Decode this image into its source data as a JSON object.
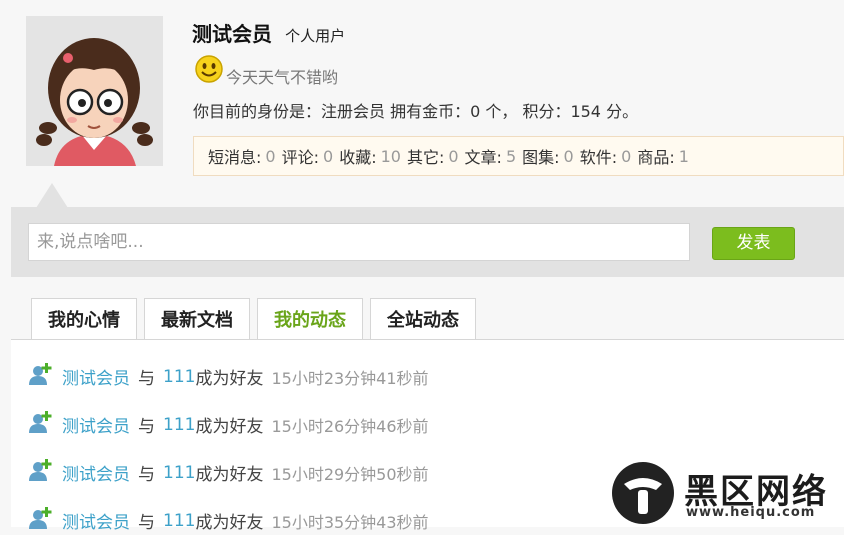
{
  "profile": {
    "name": "测试会员",
    "user_type": "个人用户",
    "mood": "今天天气不错哟",
    "identity": "你目前的身份是：注册会员 拥有金币：0 个， 积分：154 分。"
  },
  "stats": [
    {
      "label": "短消息:",
      "value": "0"
    },
    {
      "label": "评论:",
      "value": "0"
    },
    {
      "label": "收藏:",
      "value": "10"
    },
    {
      "label": "其它:",
      "value": "0"
    },
    {
      "label": "文章:",
      "value": "5"
    },
    {
      "label": "图集:",
      "value": "0"
    },
    {
      "label": "软件:",
      "value": "0"
    },
    {
      "label": "商品:",
      "value": "1"
    }
  ],
  "post": {
    "placeholder": "来,说点啥吧...",
    "submit_label": "发表"
  },
  "tabs": [
    {
      "label": "我的心情",
      "active": false
    },
    {
      "label": "最新文档",
      "active": false
    },
    {
      "label": "我的动态",
      "active": true
    },
    {
      "label": "全站动态",
      "active": false
    }
  ],
  "feed": [
    {
      "user": "测试会员",
      "with": "与",
      "friend": "111",
      "action": "成为好友",
      "time": "15小时23分钟41秒前"
    },
    {
      "user": "测试会员",
      "with": "与",
      "friend": "111",
      "action": "成为好友",
      "time": "15小时26分钟46秒前"
    },
    {
      "user": "测试会员",
      "with": "与",
      "friend": "111",
      "action": "成为好友",
      "time": "15小时29分钟50秒前"
    },
    {
      "user": "测试会员",
      "with": "与",
      "friend": "111",
      "action": "成为好友",
      "time": "15小时35分钟43秒前"
    }
  ],
  "watermark": {
    "text": "黑区网络",
    "url": "www.heiqu.com"
  },
  "colors": {
    "accent": "#7cbd1e",
    "link": "#3da1c9",
    "post_background": "#e2e2e2"
  }
}
